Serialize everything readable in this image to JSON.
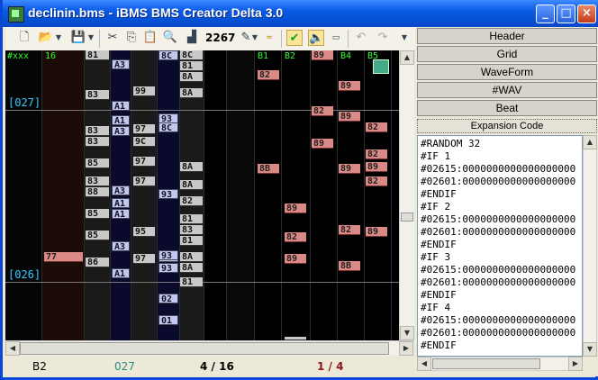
{
  "window": {
    "title": "declinin.bms - iBMS BMS Creator Delta 3.0"
  },
  "toolbar": {
    "counter": "2267"
  },
  "editor": {
    "headers": [
      "#xxx",
      "16",
      "B1",
      "B2",
      "89",
      "B4",
      "B5"
    ],
    "measures": [
      "[027]",
      "[026]"
    ],
    "notes": [
      "89",
      "82",
      "89",
      "82",
      "89",
      "82",
      "89",
      "82",
      "89",
      "8B",
      "89",
      "82",
      "82",
      "89",
      "82",
      "89",
      "89",
      "8B",
      "77",
      "8C",
      "81",
      "8A",
      "8A",
      "8A",
      "8C",
      "8C",
      "8A",
      "82",
      "81",
      "83",
      "81",
      "8A",
      "82",
      "8A",
      "81",
      "02",
      "01",
      "A3",
      "A1",
      "A3",
      "A1",
      "A3",
      "A1",
      "A1",
      "A3",
      "A1",
      "99",
      "97",
      "9C",
      "97",
      "97",
      "93",
      "93",
      "95",
      "93",
      "97",
      "93",
      "83",
      "83",
      "83",
      "88",
      "85",
      "85",
      "86",
      "83",
      "81",
      "85"
    ]
  },
  "status": {
    "channel": "B2",
    "measure": "027",
    "grid": "4 / 16",
    "beat": "1 / 4"
  },
  "panel": {
    "buttons": [
      "Header",
      "Grid",
      "WaveForm",
      "#WAV",
      "Beat"
    ],
    "expansion_label": "Expansion Code",
    "code_lines": [
      "#RANDOM 32",
      "#IF 1",
      "#02615:0000000000000000000",
      "#02601:0000000000000000000",
      "#ENDIF",
      "#IF 2",
      "#02615:0000000000000000000",
      "#02601:0000000000000000000",
      "#ENDIF",
      "#IF 3",
      "#02615:0000000000000000000",
      "#02601:0000000000000000000",
      "#ENDIF",
      "#IF 4",
      "#02615:0000000000000000000",
      "#02601:0000000000000000000",
      "#ENDIF"
    ]
  },
  "icons": {
    "new": "new-file-icon",
    "open": "open-folder-icon",
    "save": "save-icon",
    "cut": "cut-icon",
    "copy": "copy-icon",
    "paste": "paste-icon",
    "find": "search-icon",
    "stats": "chart-icon",
    "check": "checkmark-icon",
    "sound": "speaker-icon",
    "undo": "undo-icon",
    "redo": "redo-icon"
  },
  "colors": {
    "title_bar": "#0a5ae6",
    "note_red": "#d98a86",
    "note_blue": "#c0c8f0",
    "header_green": "#33ff33",
    "measure_cyan": "#33ccff"
  }
}
